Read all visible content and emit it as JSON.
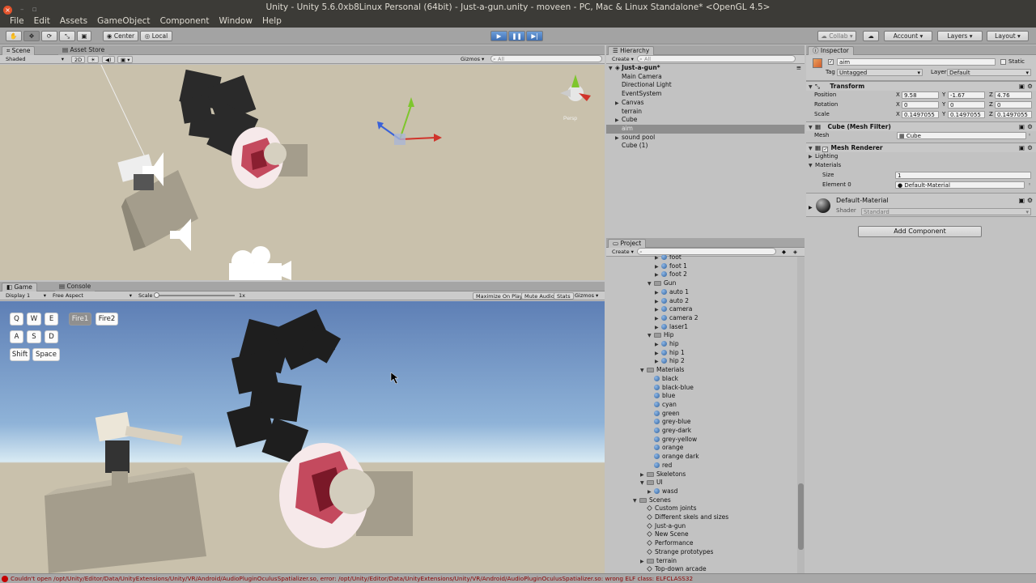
{
  "window": {
    "title": "Unity - Unity 5.6.0xb8Linux Personal (64bit) - Just-a-gun.unity - moveen - PC, Mac & Linux Standalone* <OpenGL 4.5>"
  },
  "menu": [
    "File",
    "Edit",
    "Assets",
    "GameObject",
    "Component",
    "Window",
    "Help"
  ],
  "toolbar": {
    "center": "Center",
    "local": "Local",
    "collab": "Collab",
    "account": "Account",
    "layers": "Layers",
    "layout": "Layout"
  },
  "scene": {
    "tab_scene": "Scene",
    "tab_asset_store": "Asset Store",
    "shading": "Shaded",
    "mode_2d": "2D",
    "gizmos": "Gizmos",
    "search": "All",
    "persp": "Persp"
  },
  "game": {
    "tab_game": "Game",
    "tab_console": "Console",
    "display": "Display 1",
    "aspect": "Free Aspect",
    "scale_label": "Scale",
    "scale_value": "1x",
    "maximize": "Maximize On Play",
    "mute": "Mute Audio",
    "stats": "Stats",
    "gizmos": "Gizmos",
    "keys": {
      "q": "Q",
      "w": "W",
      "e": "E",
      "a": "A",
      "s": "S",
      "d": "D",
      "shift": "Shift",
      "space": "Space",
      "fire1": "Fire1",
      "fire2": "Fire2"
    }
  },
  "hierarchy": {
    "tab": "Hierarchy",
    "create": "Create",
    "search": "All",
    "scene_name": "Just-a-gun*",
    "items": [
      "Main Camera",
      "Directional Light",
      "EventSystem",
      "Canvas",
      "terrain",
      "Cube",
      "aim",
      "sound pool",
      "Cube (1)"
    ]
  },
  "project": {
    "tab": "Project",
    "create": "Create",
    "rows": [
      {
        "label": "foot",
        "kind": "mesh",
        "indent": 6
      },
      {
        "label": "foot 1",
        "kind": "mesh",
        "indent": 6
      },
      {
        "label": "foot 2",
        "kind": "mesh",
        "indent": 6
      },
      {
        "label": "Gun",
        "kind": "folder",
        "indent": 5,
        "open": true
      },
      {
        "label": "auto 1",
        "kind": "mesh",
        "indent": 6
      },
      {
        "label": "auto 2",
        "kind": "mesh",
        "indent": 6
      },
      {
        "label": "camera",
        "kind": "mesh",
        "indent": 6
      },
      {
        "label": "camera 2",
        "kind": "mesh",
        "indent": 6
      },
      {
        "label": "laser1",
        "kind": "mesh",
        "indent": 6
      },
      {
        "label": "Hip",
        "kind": "folder",
        "indent": 5,
        "open": true
      },
      {
        "label": "hip",
        "kind": "mesh",
        "indent": 6
      },
      {
        "label": "hip 1",
        "kind": "mesh",
        "indent": 6
      },
      {
        "label": "hip 2",
        "kind": "mesh",
        "indent": 6
      },
      {
        "label": "Materials",
        "kind": "folder",
        "indent": 4,
        "open": true
      },
      {
        "label": "black",
        "kind": "material",
        "indent": 5
      },
      {
        "label": "black-blue",
        "kind": "material",
        "indent": 5
      },
      {
        "label": "blue",
        "kind": "material",
        "indent": 5
      },
      {
        "label": "cyan",
        "kind": "material",
        "indent": 5
      },
      {
        "label": "green",
        "kind": "material",
        "indent": 5
      },
      {
        "label": "grey-blue",
        "kind": "material",
        "indent": 5
      },
      {
        "label": "grey-dark",
        "kind": "material",
        "indent": 5
      },
      {
        "label": "grey-yellow",
        "kind": "material",
        "indent": 5
      },
      {
        "label": "orange",
        "kind": "material",
        "indent": 5
      },
      {
        "label": "orange dark",
        "kind": "material",
        "indent": 5
      },
      {
        "label": "red",
        "kind": "material",
        "indent": 5
      },
      {
        "label": "Skeletons",
        "kind": "folder",
        "indent": 4
      },
      {
        "label": "UI",
        "kind": "folder",
        "indent": 4,
        "open": true
      },
      {
        "label": "wasd",
        "kind": "mesh",
        "indent": 5
      },
      {
        "label": "Scenes",
        "kind": "folder",
        "indent": 3,
        "open": true
      },
      {
        "label": "Custom joints",
        "kind": "scene",
        "indent": 4
      },
      {
        "label": "Different skels and sizes",
        "kind": "scene",
        "indent": 4
      },
      {
        "label": "Just-a-gun",
        "kind": "scene",
        "indent": 4
      },
      {
        "label": "New Scene",
        "kind": "scene",
        "indent": 4
      },
      {
        "label": "Performance",
        "kind": "scene",
        "indent": 4
      },
      {
        "label": "Strange prototypes",
        "kind": "scene",
        "indent": 4
      },
      {
        "label": "terrain",
        "kind": "folder",
        "indent": 4
      },
      {
        "label": "Top-down arcade",
        "kind": "scene",
        "indent": 4
      }
    ]
  },
  "inspector": {
    "tab": "Inspector",
    "object_name": "aim",
    "static_label": "Static",
    "tag_label": "Tag",
    "tag_value": "Untagged",
    "layer_label": "Layer",
    "layer_value": "Default",
    "transform": {
      "title": "Transform",
      "position_label": "Position",
      "rotation_label": "Rotation",
      "scale_label": "Scale",
      "position": {
        "x": "9.58",
        "y": "-1.67",
        "z": "4.76"
      },
      "rotation": {
        "x": "0",
        "y": "0",
        "z": "0"
      },
      "scale": {
        "x": "0.1497055",
        "y": "0.1497055",
        "z": "0.1497055"
      },
      "x": "X",
      "y": "Y",
      "z": "Z"
    },
    "mesh_filter": {
      "title": "Cube (Mesh Filter)",
      "mesh_label": "Mesh",
      "mesh_value": "Cube"
    },
    "mesh_renderer": {
      "title": "Mesh Renderer",
      "lighting": "Lighting",
      "materials": "Materials",
      "size_label": "Size",
      "size_value": "1",
      "element_label": "Element 0",
      "element_value": "Default-Material"
    },
    "material": {
      "name": "Default-Material",
      "shader_label": "Shader",
      "shader_value": "Standard"
    },
    "add_component": "Add Component"
  },
  "status": {
    "error": "Couldn't open /opt/Unity/Editor/Data/UnityExtensions/Unity/VR/Android/AudioPluginOculusSpatializer.so, error: /opt/Unity/Editor/Data/UnityExtensions/Unity/VR/Android/AudioPluginOculusSpatializer.so: wrong ELF class: ELFCLASS32"
  }
}
